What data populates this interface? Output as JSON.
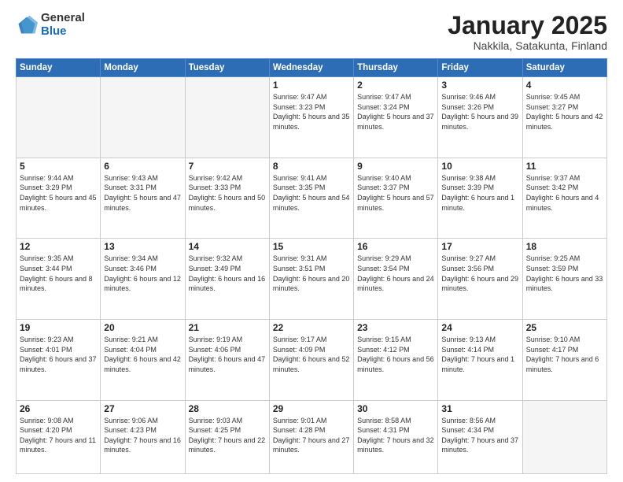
{
  "logo": {
    "general": "General",
    "blue": "Blue"
  },
  "header": {
    "title": "January 2025",
    "subtitle": "Nakkila, Satakunta, Finland"
  },
  "weekdays": [
    "Sunday",
    "Monday",
    "Tuesday",
    "Wednesday",
    "Thursday",
    "Friday",
    "Saturday"
  ],
  "weeks": [
    [
      {
        "day": "",
        "info": ""
      },
      {
        "day": "",
        "info": ""
      },
      {
        "day": "",
        "info": ""
      },
      {
        "day": "1",
        "info": "Sunrise: 9:47 AM\nSunset: 3:23 PM\nDaylight: 5 hours\nand 35 minutes."
      },
      {
        "day": "2",
        "info": "Sunrise: 9:47 AM\nSunset: 3:24 PM\nDaylight: 5 hours\nand 37 minutes."
      },
      {
        "day": "3",
        "info": "Sunrise: 9:46 AM\nSunset: 3:26 PM\nDaylight: 5 hours\nand 39 minutes."
      },
      {
        "day": "4",
        "info": "Sunrise: 9:45 AM\nSunset: 3:27 PM\nDaylight: 5 hours\nand 42 minutes."
      }
    ],
    [
      {
        "day": "5",
        "info": "Sunrise: 9:44 AM\nSunset: 3:29 PM\nDaylight: 5 hours\nand 45 minutes."
      },
      {
        "day": "6",
        "info": "Sunrise: 9:43 AM\nSunset: 3:31 PM\nDaylight: 5 hours\nand 47 minutes."
      },
      {
        "day": "7",
        "info": "Sunrise: 9:42 AM\nSunset: 3:33 PM\nDaylight: 5 hours\nand 50 minutes."
      },
      {
        "day": "8",
        "info": "Sunrise: 9:41 AM\nSunset: 3:35 PM\nDaylight: 5 hours\nand 54 minutes."
      },
      {
        "day": "9",
        "info": "Sunrise: 9:40 AM\nSunset: 3:37 PM\nDaylight: 5 hours\nand 57 minutes."
      },
      {
        "day": "10",
        "info": "Sunrise: 9:38 AM\nSunset: 3:39 PM\nDaylight: 6 hours\nand 1 minute."
      },
      {
        "day": "11",
        "info": "Sunrise: 9:37 AM\nSunset: 3:42 PM\nDaylight: 6 hours\nand 4 minutes."
      }
    ],
    [
      {
        "day": "12",
        "info": "Sunrise: 9:35 AM\nSunset: 3:44 PM\nDaylight: 6 hours\nand 8 minutes."
      },
      {
        "day": "13",
        "info": "Sunrise: 9:34 AM\nSunset: 3:46 PM\nDaylight: 6 hours\nand 12 minutes."
      },
      {
        "day": "14",
        "info": "Sunrise: 9:32 AM\nSunset: 3:49 PM\nDaylight: 6 hours\nand 16 minutes."
      },
      {
        "day": "15",
        "info": "Sunrise: 9:31 AM\nSunset: 3:51 PM\nDaylight: 6 hours\nand 20 minutes."
      },
      {
        "day": "16",
        "info": "Sunrise: 9:29 AM\nSunset: 3:54 PM\nDaylight: 6 hours\nand 24 minutes."
      },
      {
        "day": "17",
        "info": "Sunrise: 9:27 AM\nSunset: 3:56 PM\nDaylight: 6 hours\nand 29 minutes."
      },
      {
        "day": "18",
        "info": "Sunrise: 9:25 AM\nSunset: 3:59 PM\nDaylight: 6 hours\nand 33 minutes."
      }
    ],
    [
      {
        "day": "19",
        "info": "Sunrise: 9:23 AM\nSunset: 4:01 PM\nDaylight: 6 hours\nand 37 minutes."
      },
      {
        "day": "20",
        "info": "Sunrise: 9:21 AM\nSunset: 4:04 PM\nDaylight: 6 hours\nand 42 minutes."
      },
      {
        "day": "21",
        "info": "Sunrise: 9:19 AM\nSunset: 4:06 PM\nDaylight: 6 hours\nand 47 minutes."
      },
      {
        "day": "22",
        "info": "Sunrise: 9:17 AM\nSunset: 4:09 PM\nDaylight: 6 hours\nand 52 minutes."
      },
      {
        "day": "23",
        "info": "Sunrise: 9:15 AM\nSunset: 4:12 PM\nDaylight: 6 hours\nand 56 minutes."
      },
      {
        "day": "24",
        "info": "Sunrise: 9:13 AM\nSunset: 4:14 PM\nDaylight: 7 hours\nand 1 minute."
      },
      {
        "day": "25",
        "info": "Sunrise: 9:10 AM\nSunset: 4:17 PM\nDaylight: 7 hours\nand 6 minutes."
      }
    ],
    [
      {
        "day": "26",
        "info": "Sunrise: 9:08 AM\nSunset: 4:20 PM\nDaylight: 7 hours\nand 11 minutes."
      },
      {
        "day": "27",
        "info": "Sunrise: 9:06 AM\nSunset: 4:23 PM\nDaylight: 7 hours\nand 16 minutes."
      },
      {
        "day": "28",
        "info": "Sunrise: 9:03 AM\nSunset: 4:25 PM\nDaylight: 7 hours\nand 22 minutes."
      },
      {
        "day": "29",
        "info": "Sunrise: 9:01 AM\nSunset: 4:28 PM\nDaylight: 7 hours\nand 27 minutes."
      },
      {
        "day": "30",
        "info": "Sunrise: 8:58 AM\nSunset: 4:31 PM\nDaylight: 7 hours\nand 32 minutes."
      },
      {
        "day": "31",
        "info": "Sunrise: 8:56 AM\nSunset: 4:34 PM\nDaylight: 7 hours\nand 37 minutes."
      },
      {
        "day": "",
        "info": ""
      }
    ]
  ]
}
